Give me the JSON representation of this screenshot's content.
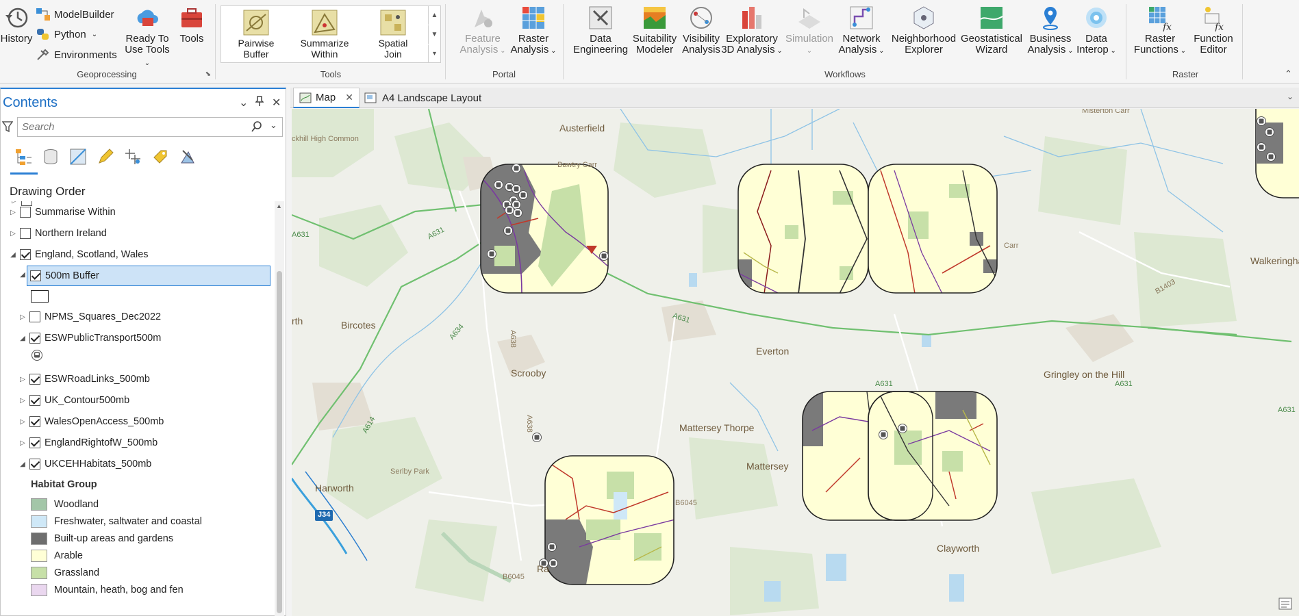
{
  "ribbon": {
    "geoprocessing": {
      "history": "History",
      "modelbuilder": "ModelBuilder",
      "python": "Python",
      "environments": "Environments",
      "ready_to_use": [
        "Ready To",
        "Use Tools"
      ],
      "tools": "Tools",
      "label": "Geoprocessing"
    },
    "tools": {
      "items": [
        [
          "Pairwise",
          "Buffer"
        ],
        [
          "Summarize",
          "Within"
        ],
        [
          "Spatial",
          "Join"
        ]
      ],
      "label": "Tools"
    },
    "portal": {
      "feature_analysis": [
        "Feature",
        "Analysis"
      ],
      "raster_analysis": [
        "Raster",
        "Analysis"
      ],
      "label": "Portal"
    },
    "workflows": {
      "items": [
        [
          "Data",
          "Engineering"
        ],
        [
          "Suitability",
          "Modeler"
        ],
        [
          "Visibility",
          "Analysis"
        ],
        [
          "Exploratory",
          "3D Analysis"
        ],
        [
          "Simulation",
          ""
        ],
        [
          "Network",
          "Analysis"
        ],
        [
          "Neighborhood",
          "Explorer"
        ],
        [
          "Geostatistical",
          "Wizard"
        ],
        [
          "Business",
          "Analysis"
        ],
        [
          "Data",
          "Interop"
        ]
      ],
      "label": "Workflows"
    },
    "raster": {
      "items": [
        [
          "Raster",
          "Functions"
        ],
        [
          "Function",
          "Editor"
        ]
      ],
      "label": "Raster"
    }
  },
  "contents": {
    "title": "Contents",
    "search_placeholder": "Search",
    "section": "Drawing Order",
    "layers": {
      "summarise_within": "Summarise Within",
      "northern_ireland": "Northern Ireland",
      "esw": "England, Scotland, Wales",
      "buffer": "500m Buffer",
      "npms": "NPMS_Squares_Dec2022",
      "transport": "ESWPublicTransport500m",
      "roadlinks": "ESWRoadLinks_500mb",
      "contour": "UK_Contour500mb",
      "wales": "WalesOpenAccess_500mb",
      "england_row": "EnglandRightofW_500mb",
      "habitats": "UKCEHHabitats_500mb"
    },
    "legend": {
      "heading": "Habitat Group",
      "items": [
        {
          "label": "Woodland",
          "color": "#a3c6a8"
        },
        {
          "label": "Freshwater, saltwater and coastal",
          "color": "#cfe8f7"
        },
        {
          "label": "Built-up areas and gardens",
          "color": "#6e6e6e"
        },
        {
          "label": "Arable",
          "color": "#ffffd6"
        },
        {
          "label": "Grassland",
          "color": "#c7e0a8"
        },
        {
          "label": "Mountain, heath, bog and fen",
          "color": "#ead7ef"
        }
      ]
    }
  },
  "tabs": [
    {
      "label": "Map"
    },
    {
      "label": "A4 Landscape Layout"
    }
  ],
  "map": {
    "places": {
      "austerfield": "Austerfield",
      "bawtry": "Bawtry Carr",
      "blaxton": "ckhill High Common",
      "bircotes": "Bircotes",
      "scrooby": "Scrooby",
      "everton": "Everton",
      "mattersey_thorpe": "Mattersey Thorpe",
      "mattersey": "Mattersey",
      "gringley": "Gringley on the Hill",
      "harworth": "Harworth",
      "serlby": "Serlby Park",
      "clayworth": "Clayworth",
      "walkeringham": "Walkeringha",
      "misterton": "Misterton Carr",
      "carr": "Carr",
      "rth": "rth",
      "ra": "Ra"
    },
    "roads": {
      "a631_1": "A631",
      "a631_2": "A631",
      "a631_3": "A631",
      "a631_4": "A631",
      "a631_5": "A631",
      "a634": "A634",
      "a614": "A614",
      "a638": "A638",
      "a638b": "A638",
      "b6045": "B6045",
      "b6045b": "B6045",
      "b1403": "B1403",
      "j34": "J34"
    }
  },
  "colors": {
    "accent": "#2a7fd4",
    "arable": "#ffffd6",
    "builtup": "#6e6e6e",
    "woodland": "#a3c6a8",
    "grassland": "#c7e0a8",
    "road_green": "#6bbf6b",
    "river": "#4aa3df"
  }
}
